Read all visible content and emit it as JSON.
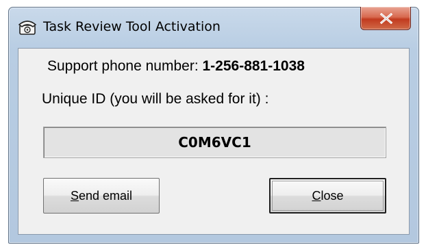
{
  "window": {
    "title": "Task Review Tool Activation",
    "title_icon": "telephone-icon",
    "close_icon": "close-icon"
  },
  "support": {
    "label": "Support phone number: ",
    "phone": "1-256-881-1038"
  },
  "unique_id": {
    "label": "Unique ID (you will be asked for it) :",
    "value": "C0M6VC1"
  },
  "buttons": {
    "send_email": {
      "accel": "S",
      "rest": "end email"
    },
    "close": {
      "accel": "C",
      "rest": "lose"
    }
  },
  "colors": {
    "titlebar": "#b8cde3",
    "close_button": "#c23b1f",
    "client_background": "#f0f0f0"
  }
}
